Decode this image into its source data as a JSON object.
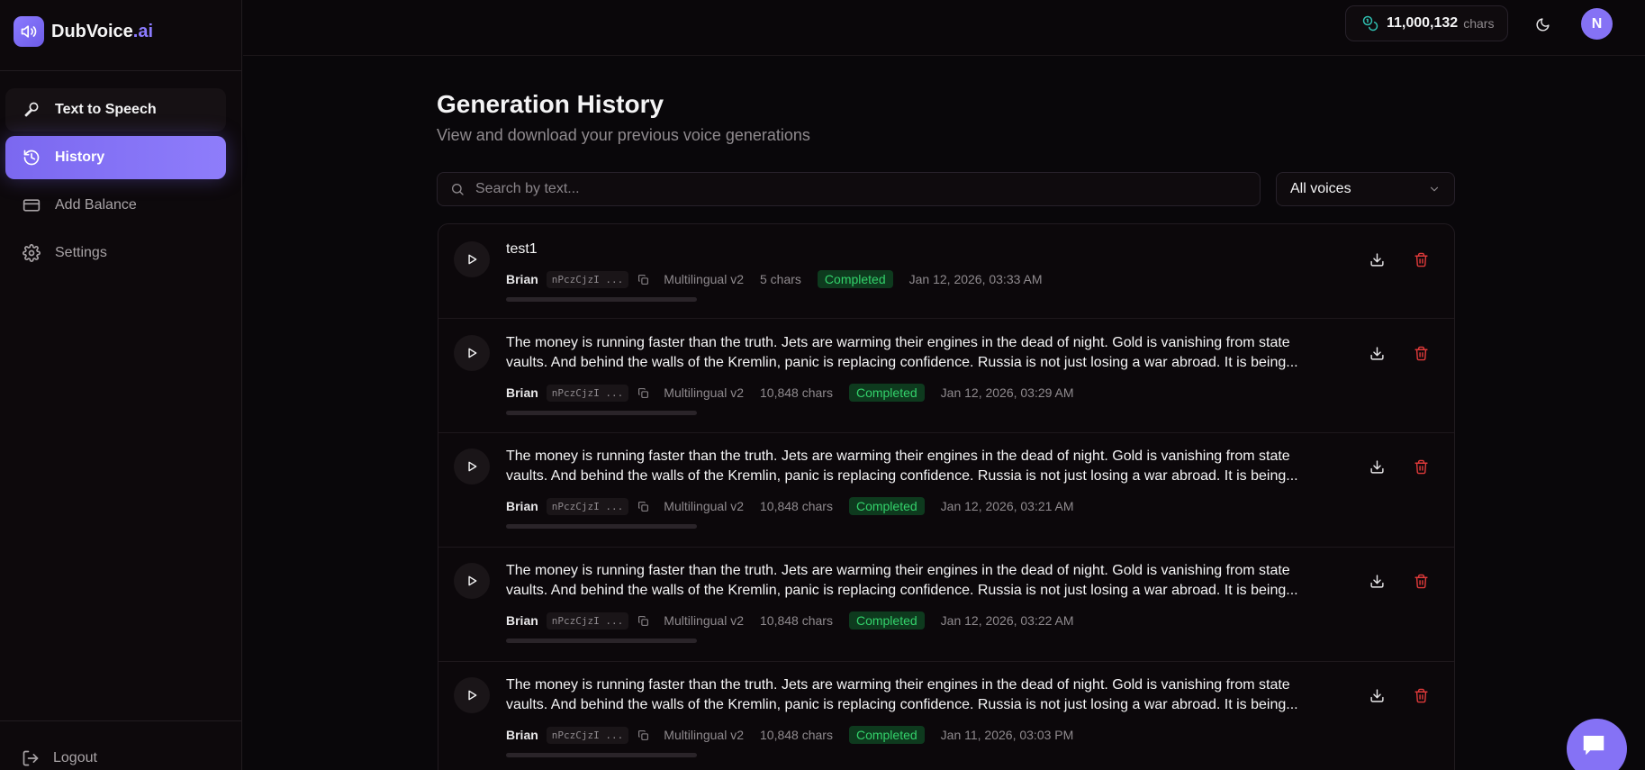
{
  "brand": {
    "name": "DubVoice",
    "suffix": ".ai",
    "logo_icon": "speaker-icon"
  },
  "sidebar": {
    "items": [
      {
        "label": "Text to Speech",
        "icon": "microphone-pen-icon",
        "active": false
      },
      {
        "label": "History",
        "icon": "history-icon",
        "active": true
      },
      {
        "label": "Add Balance",
        "icon": "credit-card-icon",
        "active": false
      },
      {
        "label": "Settings",
        "icon": "gear-icon",
        "active": false
      }
    ],
    "logout_label": "Logout"
  },
  "topbar": {
    "balance_value": "11,000,132",
    "balance_unit": "chars",
    "avatar_initial": "N"
  },
  "page": {
    "title": "Generation History",
    "subtitle": "View and download your previous voice generations"
  },
  "search": {
    "placeholder": "Search by text...",
    "value": ""
  },
  "filter": {
    "selected": "All voices"
  },
  "history": [
    {
      "text": "test1",
      "voice": "Brian",
      "voice_id": "nPczCjzI ...",
      "model": "Multilingual v2",
      "chars": "5 chars",
      "status": "Completed",
      "date": "Jan 12, 2026, 03:33 AM",
      "progress": 0
    },
    {
      "text": "The money is running faster than the truth. Jets are warming their engines in the dead of night. Gold is vanishing from state vaults. And behind the walls of the Kremlin, panic is replacing confidence. Russia is not just losing a war abroad. It is being...",
      "voice": "Brian",
      "voice_id": "nPczCjzI ...",
      "model": "Multilingual v2",
      "chars": "10,848 chars",
      "status": "Completed",
      "date": "Jan 12, 2026, 03:29 AM",
      "progress": 0
    },
    {
      "text": "The money is running faster than the truth. Jets are warming their engines in the dead of night. Gold is vanishing from state vaults. And behind the walls of the Kremlin, panic is replacing confidence. Russia is not just losing a war abroad. It is being...",
      "voice": "Brian",
      "voice_id": "nPczCjzI ...",
      "model": "Multilingual v2",
      "chars": "10,848 chars",
      "status": "Completed",
      "date": "Jan 12, 2026, 03:21 AM",
      "progress": 0
    },
    {
      "text": "The money is running faster than the truth. Jets are warming their engines in the dead of night. Gold is vanishing from state vaults. And behind the walls of the Kremlin, panic is replacing confidence. Russia is not just losing a war abroad. It is being...",
      "voice": "Brian",
      "voice_id": "nPczCjzI ...",
      "model": "Multilingual v2",
      "chars": "10,848 chars",
      "status": "Completed",
      "date": "Jan 12, 2026, 03:22 AM",
      "progress": 0
    },
    {
      "text": "The money is running faster than the truth. Jets are warming their engines in the dead of night. Gold is vanishing from state vaults. And behind the walls of the Kremlin, panic is replacing confidence. Russia is not just losing a war abroad. It is being...",
      "voice": "Brian",
      "voice_id": "nPczCjzI ...",
      "model": "Multilingual v2",
      "chars": "10,848 chars",
      "status": "Completed",
      "date": "Jan 11, 2026, 03:03 PM",
      "progress": 0
    }
  ],
  "colors": {
    "accent": "#8572f5",
    "background": "#09070a",
    "status_completed_bg": "#0e3a1e",
    "status_completed_text": "#33d26b",
    "delete": "#e03a3a"
  }
}
